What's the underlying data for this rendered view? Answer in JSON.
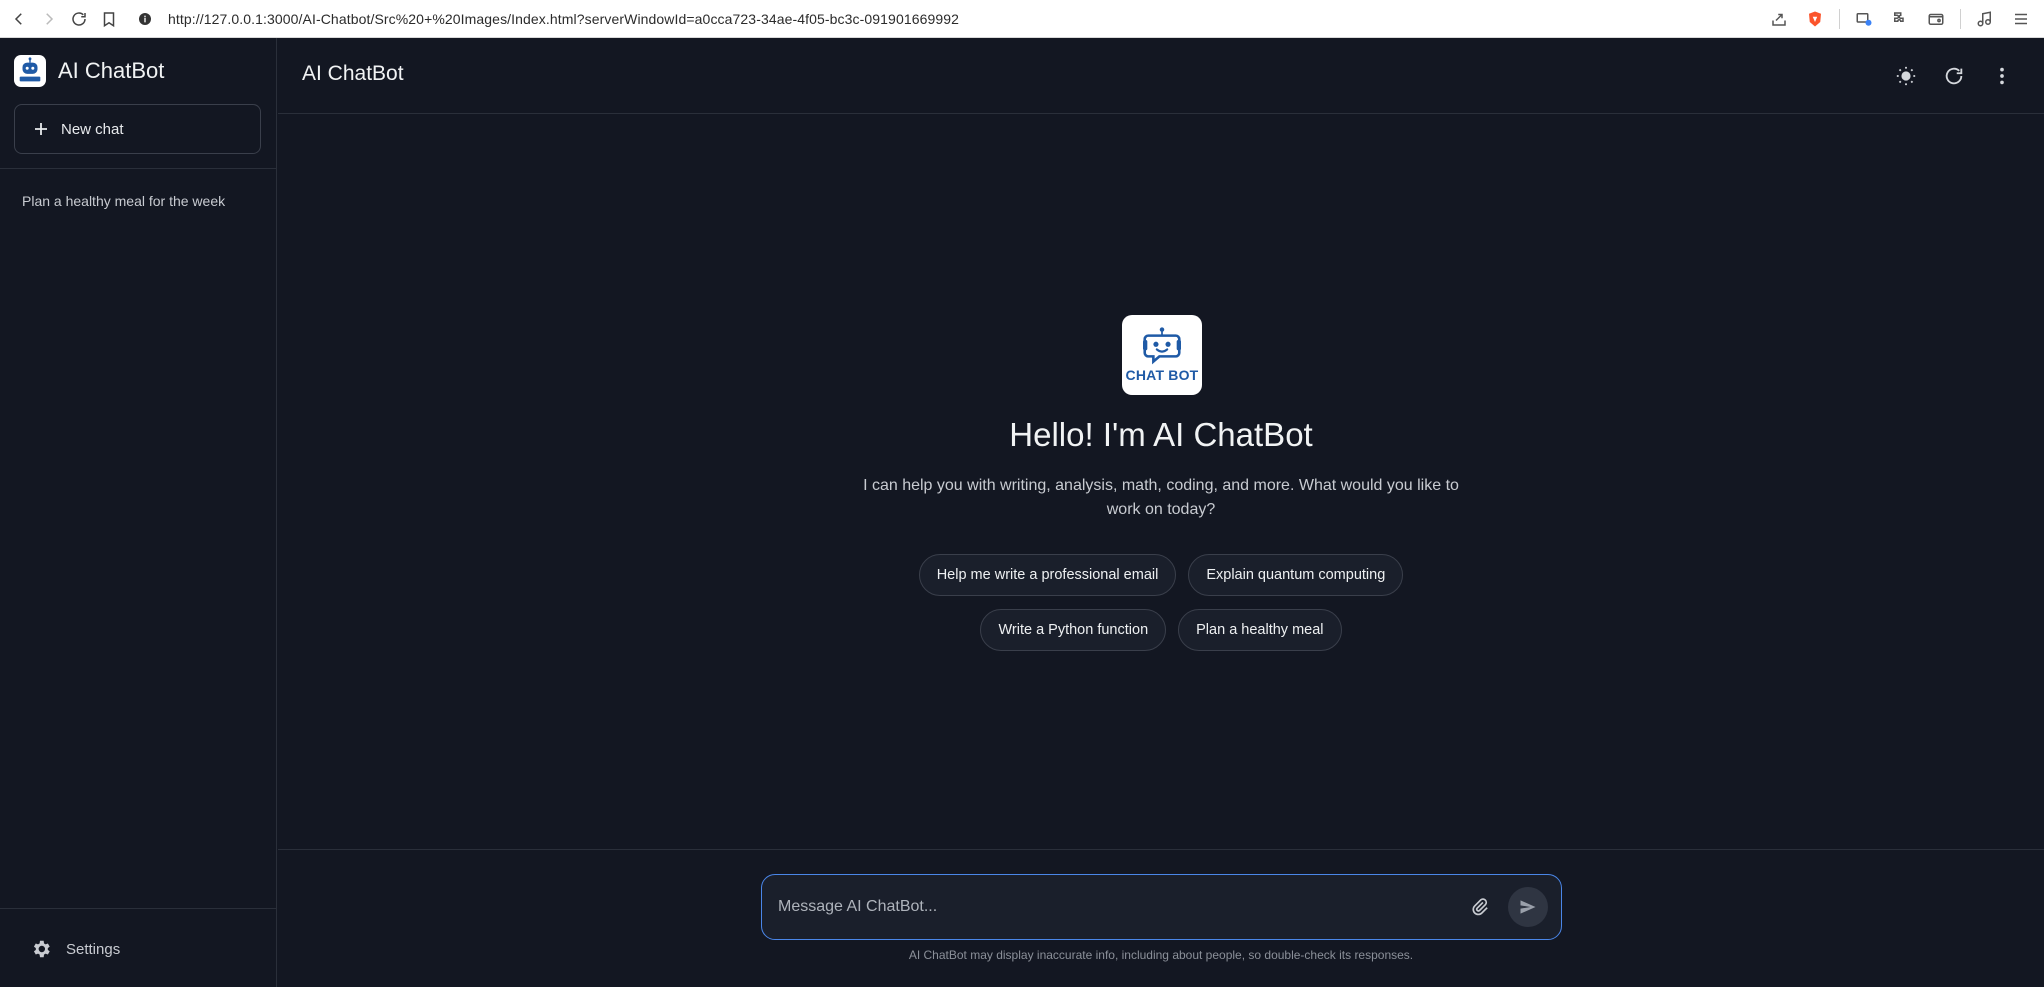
{
  "browser": {
    "url": "http://127.0.0.1:3000/AI-Chatbot/Src%20+%20Images/Index.html?serverWindowId=a0cca723-34ae-4f05-bc3c-091901669992"
  },
  "sidebar": {
    "brand_title": "AI ChatBot",
    "new_chat_label": "New chat",
    "history": [
      {
        "label": "Plan a healthy meal for the week"
      }
    ],
    "settings_label": "Settings"
  },
  "header": {
    "title": "AI ChatBot"
  },
  "hero": {
    "logo_text": "CHAT BOT",
    "title": "Hello! I'm AI ChatBot",
    "subtitle": "I can help you with writing, analysis, math, coding, and more. What would you like to work on today?"
  },
  "suggestions": [
    {
      "label": "Help me write a professional email"
    },
    {
      "label": "Explain quantum computing"
    },
    {
      "label": "Write a Python function"
    },
    {
      "label": "Plan a healthy meal"
    }
  ],
  "composer": {
    "placeholder": "Message AI ChatBot...",
    "disclaimer": "AI ChatBot may display inaccurate info, including about people, so double-check its responses."
  },
  "colors": {
    "background": "#131722",
    "accent": "#4a86e8",
    "brand_blue": "#1f5aa6"
  }
}
